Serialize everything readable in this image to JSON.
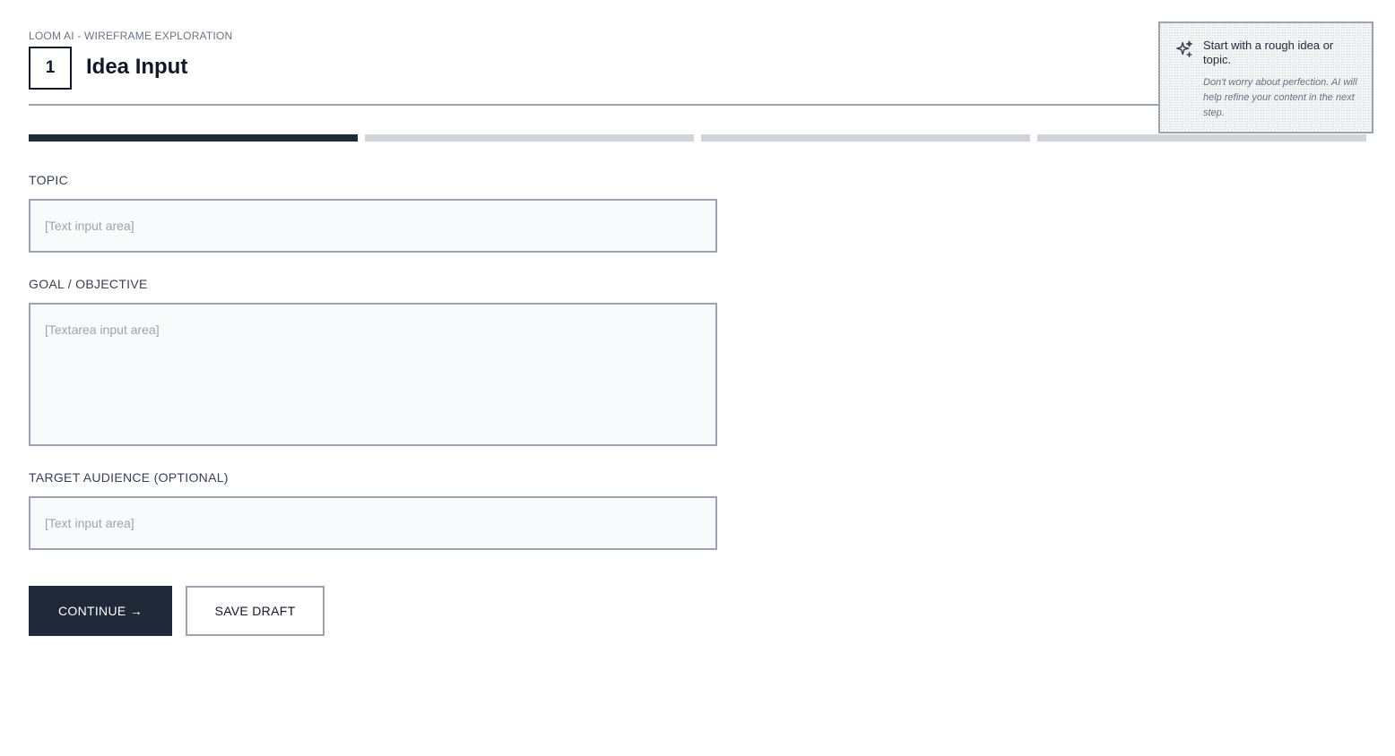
{
  "header": {
    "eyebrow": "LOOM AI - WIREFRAME EXPLORATION",
    "step_number": "1",
    "title": "Idea Input"
  },
  "progress": {
    "total_steps": 4,
    "current_step": 1
  },
  "form": {
    "topic": {
      "label": "TOPIC",
      "placeholder": "[Text input area]",
      "value": ""
    },
    "goal": {
      "label": "GOAL / OBJECTIVE",
      "placeholder": "[Textarea input area]",
      "value": ""
    },
    "audience": {
      "label": "TARGET AUDIENCE (OPTIONAL)",
      "placeholder": "[Text input area]",
      "value": ""
    }
  },
  "actions": {
    "continue_label": "CONTINUE →",
    "save_draft_label": "SAVE DRAFT"
  },
  "tip": {
    "icon": "sparkles-icon",
    "title": "Start with a rough idea or topic.",
    "body": "Don't worry about perfection. AI will help refine your content in the next step."
  },
  "colors": {
    "primary": "#1f2937",
    "border": "#9ca3af",
    "field_bg": "#f8fafc",
    "progress_inactive": "#d1d5db"
  }
}
